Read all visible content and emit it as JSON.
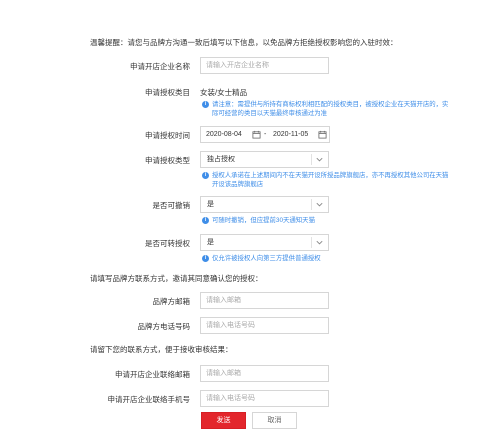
{
  "notice": "温馨提醒：请您与品牌方沟通一致后填写以下信息，以免品牌方拒绝授权影响您的入驻时效：",
  "fields": {
    "company_name": {
      "label": "申请开店企业名称",
      "placeholder": "请输入开店企业名称"
    },
    "category": {
      "label": "申请授权类目",
      "value": "女装/女士精品"
    },
    "category_hint": "请注意：需提供与所持有商标权利相匹配的授权类目，被授权企业在天猫开店的，实际可经营的类目以天猫最终审核通过为准",
    "auth_period": {
      "label": "申请授权时间",
      "start": "2020-08-04",
      "separator": "-",
      "end": "2020-11-05"
    },
    "auth_type": {
      "label": "申请授权类型",
      "value": "独占授权"
    },
    "auth_type_hint": "授权人承诺在上述期间内不在天猫开设所授品牌旗舰店，亦不再授权其他公司在天猫开设该品牌旗舰店",
    "revocable": {
      "label": "是否可撤销",
      "value": "是"
    },
    "revocable_hint": "可随时撤销，但应提前30天通知天猫",
    "transferable": {
      "label": "是否可转授权",
      "value": "是"
    },
    "transferable_hint": "仅允许被授权人向第三方提供普通授权"
  },
  "brand_section": {
    "title": "请填写品牌方联系方式，邀请其同意确认您的授权：",
    "email": {
      "label": "品牌方邮箱",
      "placeholder": "请输入邮箱"
    },
    "phone": {
      "label": "品牌方电话号码",
      "placeholder": "请输入电话号码"
    }
  },
  "contact_section": {
    "title": "请留下您的联系方式，便于接收审核结果：",
    "email": {
      "label": "申请开店企业联络邮箱",
      "placeholder": "请输入邮箱"
    },
    "phone": {
      "label": "申请开店企业联络手机号",
      "placeholder": "请输入电话号码"
    }
  },
  "buttons": {
    "submit": "发送",
    "cancel": "取消"
  },
  "colors": {
    "primary": "#e3262c",
    "hint": "#3f8ee8",
    "border": "#d6d6d6"
  },
  "icons": [
    "calendar-icon",
    "chevron-down-icon",
    "info-icon"
  ]
}
